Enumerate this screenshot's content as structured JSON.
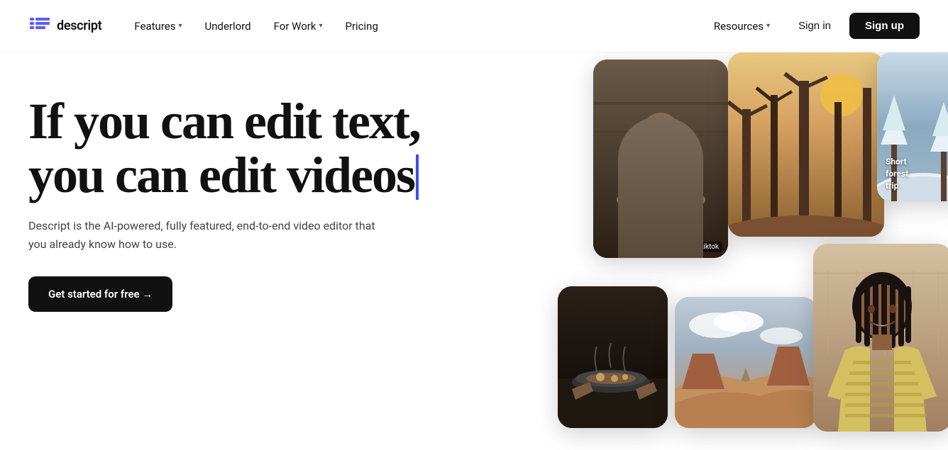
{
  "nav": {
    "logo": {
      "text": "descript"
    },
    "items": [
      {
        "label": "Features",
        "has_dropdown": true
      },
      {
        "label": "Underlord",
        "has_dropdown": false
      },
      {
        "label": "For Work",
        "has_dropdown": true
      },
      {
        "label": "Pricing",
        "has_dropdown": false
      }
    ],
    "right_items": [
      {
        "label": "Resources",
        "has_dropdown": true
      },
      {
        "label": "Sign in",
        "has_dropdown": false
      },
      {
        "label": "Sign up",
        "is_cta": true
      }
    ]
  },
  "hero": {
    "title_line1": "If you can edit text,",
    "title_line2": "you can edit videos",
    "subtitle": "Descript is the AI-powered, fully featured, end-to-end video editor that you already know how to use.",
    "cta_label": "Get started for free →",
    "cursor_color": "#3b4ef8"
  },
  "media": {
    "cards": [
      {
        "id": "card-1",
        "description": "person in studio"
      },
      {
        "id": "card-2",
        "description": "trees nature"
      },
      {
        "id": "card-3",
        "description": "snowy scene",
        "overlay_text": "Short\nforest\ntrip"
      },
      {
        "id": "card-4",
        "description": "cooking dark"
      },
      {
        "id": "card-5",
        "description": "desert landscape"
      },
      {
        "id": "card-6",
        "description": "woman smiling"
      }
    ]
  }
}
